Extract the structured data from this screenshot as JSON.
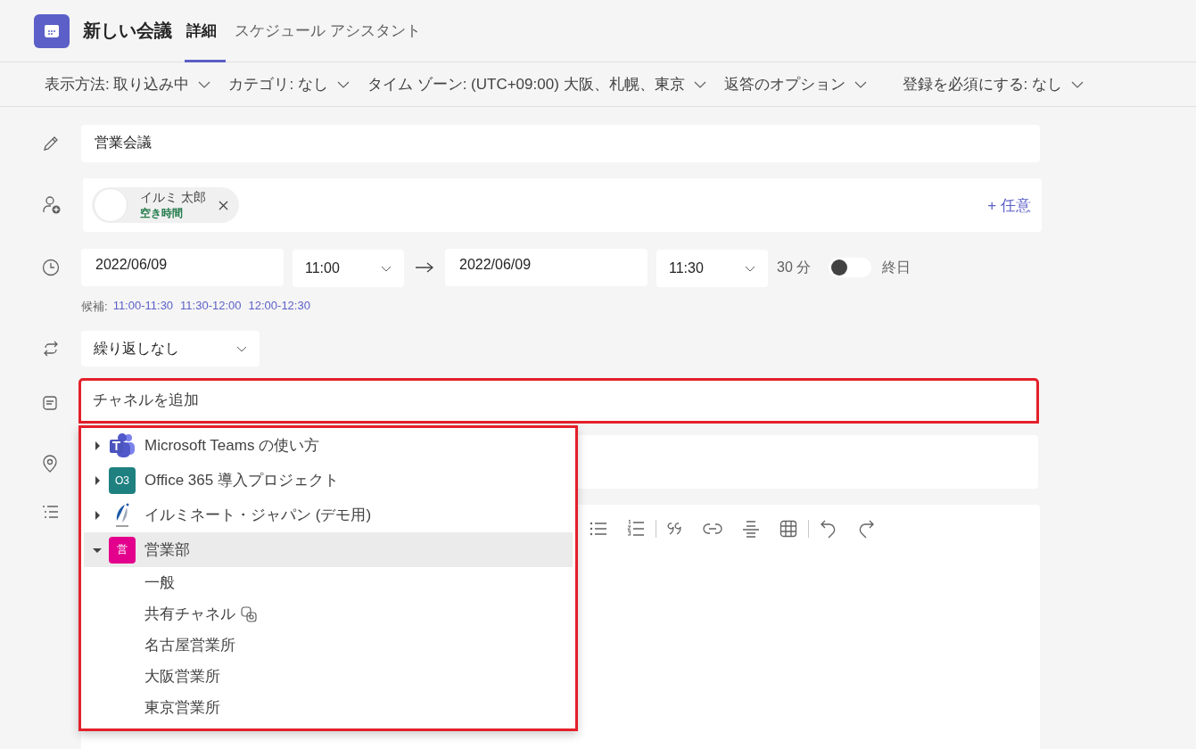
{
  "header": {
    "title": "新しい会議",
    "tabs": [
      {
        "label": "詳細",
        "selected": true
      },
      {
        "label": "スケジュール アシスタント",
        "selected": false
      }
    ]
  },
  "options": [
    "表示方法: 取り込み中",
    "カテゴリ: なし",
    "タイム ゾーン: (UTC+09:00) 大阪、札幌、東京",
    "返答のオプション",
    "登録を必須にする: なし"
  ],
  "title_field": {
    "value": "営業会議"
  },
  "attendees": {
    "chips": [
      {
        "name": "イルミ 太郎",
        "status": "空き時間"
      }
    ],
    "optional": "+ 任意"
  },
  "time": {
    "start_date": "2022/06/09",
    "start_time": "11:00",
    "end_date": "2022/06/09",
    "end_time": "11:30",
    "duration": "30 分",
    "all_day": {
      "label": "終日",
      "on": false
    }
  },
  "suggestions": {
    "label": "候補:",
    "slots": [
      "11:00-11:30",
      "11:30-12:00",
      "12:00-12:30"
    ]
  },
  "repeat": {
    "value": "繰り返しなし"
  },
  "channel": {
    "placeholder": "チャネルを追加",
    "highlighted": true
  },
  "channel_menu": {
    "highlighted": true,
    "teams": [
      {
        "name": "Microsoft Teams の使い方",
        "expanded": false,
        "selected": false,
        "logo": {
          "kind": "teams"
        }
      },
      {
        "name": "Office 365 導入プロジェクト",
        "expanded": false,
        "selected": false,
        "logo": {
          "kind": "initials",
          "text": "O3",
          "color": "#1f8080"
        }
      },
      {
        "name": "イルミネート・ジャパン (デモ用)",
        "expanded": false,
        "selected": false,
        "logo": {
          "kind": "image"
        }
      },
      {
        "name": "営業部",
        "expanded": true,
        "selected": true,
        "logo": {
          "kind": "initials",
          "text": "営",
          "color": "#e3008c"
        },
        "children": [
          {
            "name": "一般",
            "shared": false
          },
          {
            "name": "共有チャネル",
            "shared": true
          },
          {
            "name": "名古屋営業所",
            "shared": false
          },
          {
            "name": "大阪営業所",
            "shared": false
          },
          {
            "name": "東京営業所",
            "shared": false
          }
        ]
      }
    ]
  }
}
